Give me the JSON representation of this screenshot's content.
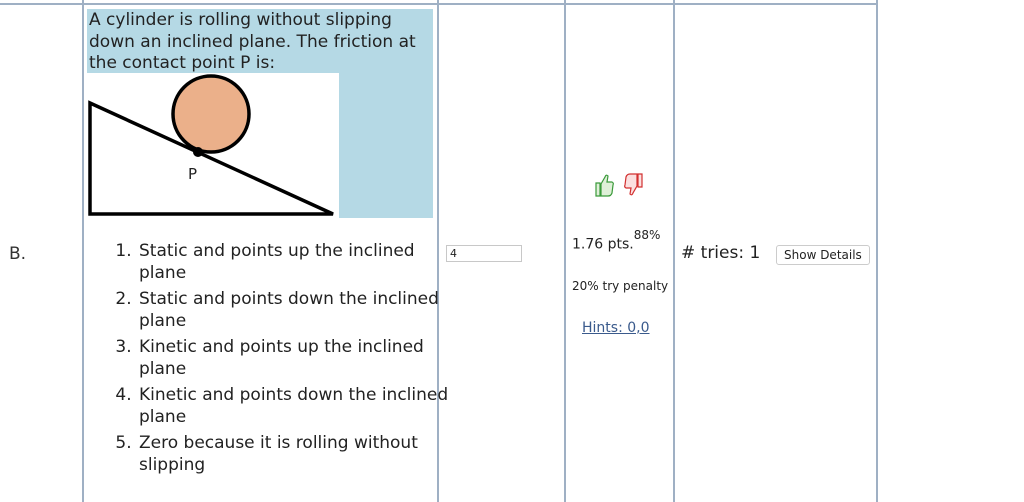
{
  "row_label": "B.",
  "question": {
    "text": "A cylinder is rolling without slipping down an inclined plane. The friction at the contact point P is:",
    "diagram_point_label": "P"
  },
  "choices": [
    "Static and points up the inclined plane",
    "Static and points down the inclined plane",
    "Kinetic and points up the inclined plane",
    "Kinetic and points down the inclined plane",
    "Zero because it is rolling without slipping"
  ],
  "answer": {
    "value": "4"
  },
  "score": {
    "points": "1.76 pts.",
    "percent": "88%",
    "penalty": "20% try penalty",
    "hints_link": "Hints: 0,0"
  },
  "feedback": {
    "thumbs_up_icon": "thumbs-up-icon",
    "thumbs_down_icon": "thumbs-down-icon",
    "up_color": "#3a9a3a",
    "down_color": "#d23030"
  },
  "tries": {
    "label": "# tries: 1",
    "details_button": "Show Details"
  }
}
